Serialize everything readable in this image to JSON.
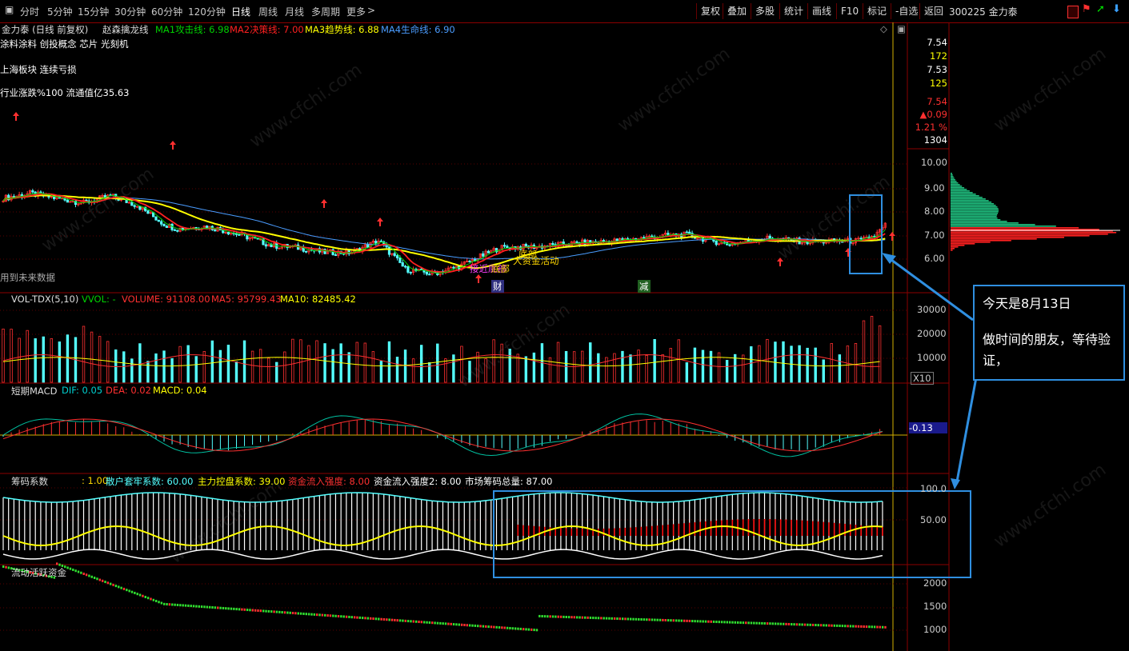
{
  "toolbar": {
    "periods": [
      "分时",
      "5分钟",
      "15分钟",
      "30分钟",
      "60分钟",
      "120分钟",
      "日线",
      "周线",
      "月线",
      "多周期",
      "更多"
    ],
    "active": "日线",
    "right_buttons": [
      "复权",
      "叠加",
      "多股",
      "统计",
      "画线",
      "F10",
      "标记",
      "-自选",
      "返回"
    ],
    "symbol": "300225 金力泰"
  },
  "main_panel": {
    "title": "金力泰 (日线 前复权)",
    "indicator": "赵森擒龙线",
    "ma_labels": [
      {
        "text": "MA1攻击线: 6.98",
        "color": "#00d000"
      },
      {
        "text": "MA2决策线: 7.00",
        "color": "#ff2020"
      },
      {
        "text": "MA3趋势线: 6.88",
        "color": "#ffff00"
      },
      {
        "text": "MA4生命线: 6.90",
        "color": "#4a9cff"
      }
    ],
    "concepts": "涂料涂料 创投概念 芯片 光刻机",
    "sector": "上海板块 连续亏损",
    "industry": "行业涨跌%100  流通值亿35.63",
    "future_note": "用到未来数据",
    "annotations": [
      "接近底部",
      "底部",
      "底部",
      "大资金活动"
    ],
    "markers": [
      "财",
      "减"
    ],
    "y_ticks": [
      "10.00",
      "9.00",
      "8.00",
      "7.00",
      "6.00"
    ],
    "info_values": [
      {
        "text": "7.54",
        "color": "#ffffff"
      },
      {
        "text": "172",
        "color": "#ffff00"
      },
      {
        "text": "7.53",
        "color": "#ffffff"
      },
      {
        "text": "125",
        "color": "#ffff00"
      },
      {
        "text": "7.54",
        "color": "#ff3030"
      },
      {
        "text": "▲0.09",
        "color": "#ff3030"
      },
      {
        "text": "1.21 %",
        "color": "#ff3030"
      },
      {
        "text": "1304",
        "color": "#ffffff"
      }
    ]
  },
  "volume_panel": {
    "title": "VOL-TDX(5,10)",
    "vvol": "VVOL: -",
    "volume": "VOLUME: 91108.00",
    "ma5": "MA5: 95799.43",
    "ma10": "MA10: 82485.42",
    "y_ticks": [
      "30000",
      "20000",
      "10000"
    ],
    "unit": "X10"
  },
  "macd_panel": {
    "title": "短期MACD",
    "dif": "DIF: 0.05",
    "dea": "DEA: 0.02",
    "macd": "MACD: 0.04",
    "current": "-0.13"
  },
  "chip_panel": {
    "title": "筹码系数",
    "v1": ": 1.00",
    "retail": "散户套牢系数: 60.00",
    "control": "主力控盘系数: 39.00",
    "inflow": "资金流入强度: 8.00",
    "inflow2": "资金流入强度2: 8.00",
    "total": "市场筹码总量: 87.00",
    "y_ticks": [
      "100.0",
      "50.00"
    ]
  },
  "flow_panel": {
    "title": "流动活跃资金",
    "y_ticks": [
      "2000",
      "1500",
      "1000"
    ]
  },
  "callout": {
    "line1": "今天是8月13日",
    "line2": "做时间的朋友，等待验证，"
  },
  "watermark": "www.cfchi.com",
  "colors": {
    "up": "#ff3030",
    "down": "#54ffff",
    "ma1": "#00d000",
    "ma2": "#ff2020",
    "ma3": "#ffff00",
    "ma4": "#4a9cff",
    "callout": "#2f8fe0"
  },
  "chart_data": {
    "type": "candlestick",
    "price_anchors": [
      [
        0,
        8.6
      ],
      [
        10,
        8.8
      ],
      [
        20,
        8.6
      ],
      [
        30,
        8.4
      ],
      [
        40,
        8.7
      ],
      [
        50,
        8.3
      ],
      [
        60,
        7.5
      ],
      [
        65,
        7.3
      ],
      [
        75,
        7.4
      ],
      [
        80,
        7.3
      ],
      [
        90,
        7.0
      ],
      [
        100,
        6.6
      ],
      [
        110,
        6.5
      ],
      [
        120,
        6.3
      ],
      [
        130,
        6.3
      ],
      [
        140,
        6.8
      ],
      [
        150,
        5.6
      ],
      [
        160,
        5.4
      ],
      [
        170,
        5.7
      ],
      [
        185,
        6.5
      ],
      [
        200,
        6.55
      ],
      [
        215,
        6.7
      ],
      [
        230,
        6.8
      ],
      [
        245,
        7.0
      ],
      [
        255,
        7.05
      ],
      [
        270,
        6.65
      ],
      [
        285,
        6.9
      ],
      [
        300,
        6.75
      ],
      [
        320,
        6.8
      ],
      [
        325,
        7.0
      ],
      [
        330,
        7.54
      ]
    ],
    "ma_values": {
      "MA1": 6.98,
      "MA2": 7.0,
      "MA3": 6.88,
      "MA4": 6.9
    },
    "volume": {
      "last": 91108,
      "ma5": 95799.43,
      "ma10": 82485.42
    },
    "macd": {
      "dif": 0.05,
      "dea": 0.02,
      "macd": 0.04
    },
    "chip": {
      "retail": 60,
      "control": 39,
      "inflow": 8,
      "total": 87
    }
  }
}
